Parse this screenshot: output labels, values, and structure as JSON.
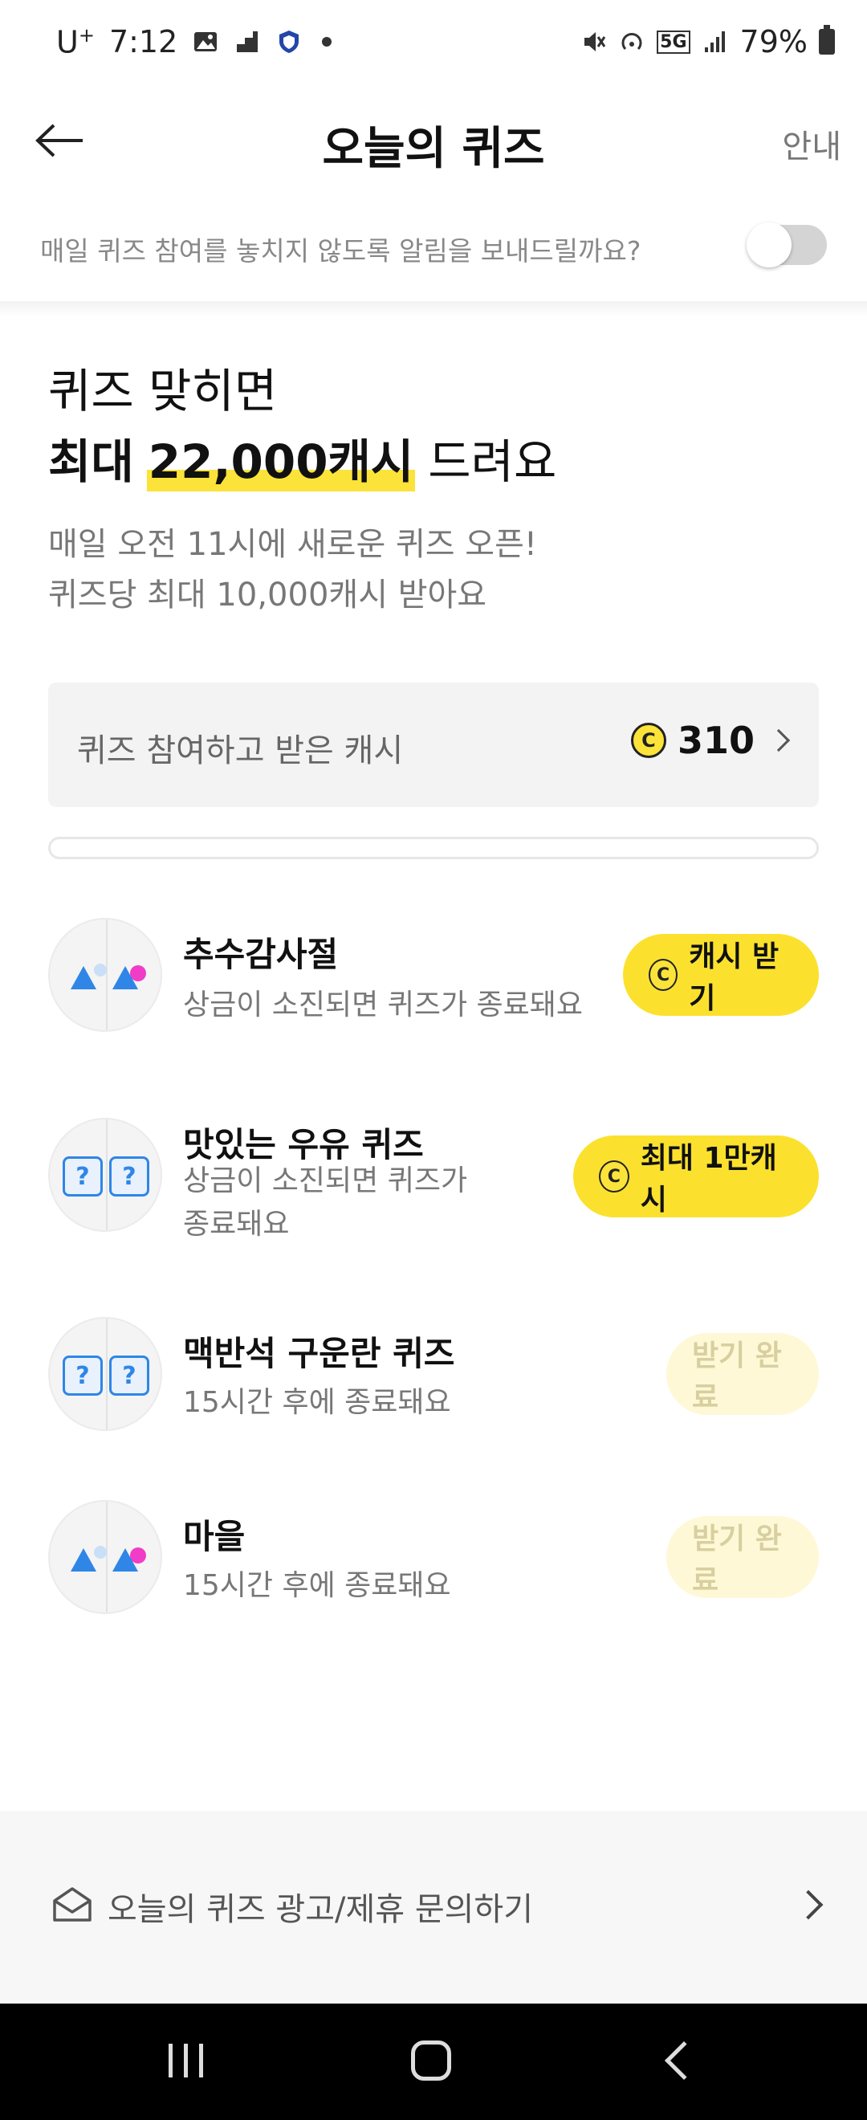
{
  "status_bar": {
    "carrier": "U",
    "carrier_plus": "+",
    "time": "7:12",
    "network": "5G",
    "battery": "79%"
  },
  "header": {
    "title": "오늘의 퀴즈",
    "guide_label": "안내"
  },
  "notification": {
    "text": "매일 퀴즈 참여를 놓치지 않도록 알림을 보내드릴까요?",
    "enabled": false
  },
  "hero": {
    "line1": "퀴즈 맞히면",
    "line2_prefix": "최대",
    "line2_amount": "22,000캐시",
    "line2_suffix": "드려요",
    "sub1": "매일 오전 11시에 새로운 퀴즈 오픈!",
    "sub2": "퀴즈당 최대 10,000캐시 받아요"
  },
  "cash_card": {
    "label": "퀴즈 참여하고 받은 캐시",
    "coin_symbol": "C",
    "value": "310"
  },
  "quizzes": [
    {
      "title": "추수감사절",
      "subtitle": "상금이 소진되면 퀴즈가 종료돼요",
      "button": "캐시 받기",
      "coin": "C",
      "state": "active",
      "icon": "triangles-icon"
    },
    {
      "title": "맛있는 우유 퀴즈",
      "subtitle": "상금이 소진되면 퀴즈가 종료돼요",
      "subtitle_line1": "상금이 소진되면 퀴즈가",
      "subtitle_line2": "종료돼요",
      "button": "최대 1만캐시",
      "coin": "C",
      "state": "active",
      "icon": "question-marks-icon",
      "qmark": "?"
    },
    {
      "title": "맥반석 구운란 퀴즈",
      "subtitle": "15시간 후에 종료돼요",
      "button": "받기 완료",
      "state": "done",
      "icon": "question-marks-icon",
      "qmark": "?"
    },
    {
      "title": "마을",
      "subtitle": "15시간 후에 종료돼요",
      "button": "받기 완료",
      "state": "done",
      "icon": "triangles-icon"
    }
  ],
  "footer": {
    "inquiry_label": "오늘의 퀴즈 광고/제휴 문의하기"
  },
  "colors": {
    "accent_yellow": "#fbe12e",
    "done_bg": "#fff8d6",
    "blue": "#2f86e6",
    "pink": "#f13cc8"
  }
}
